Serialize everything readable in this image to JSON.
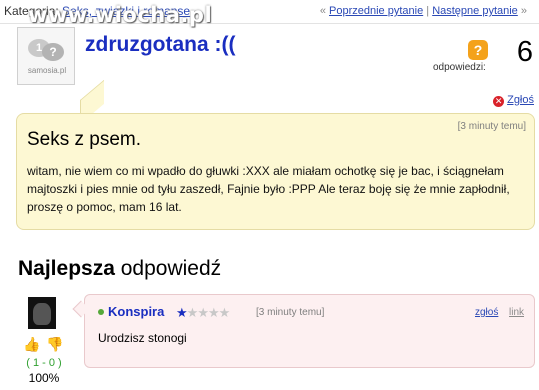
{
  "topbar": {
    "category_label": "Kategoria:",
    "category_link": "Seks, związki i romanse",
    "watermark": "www.wiocha.pl",
    "prev_link": "Poprzednie pytanie",
    "separator": "|",
    "next_link": "Następne pytanie",
    "prev_arrow": "«",
    "next_arrow": "»"
  },
  "asker": {
    "avatar_text": "samosia.pl",
    "avatar_glyph_1": "1",
    "avatar_glyph_2": "?",
    "username": "zdruzgotana :(("
  },
  "answers": {
    "count": "6",
    "label": "odpowiedzi:",
    "icon": "question-icon"
  },
  "report": {
    "label": "Zgłoś"
  },
  "question": {
    "time": "[3 minuty temu]",
    "title": "Seks z psem.",
    "body": "witam, nie wiem co mi wpadło do głuwki :XXX ale miałam ochotkę się je bac, i ściągnełam majtoszki i pies mnie od tyłu zaszedł, Fajnie było :PPP Ale teraz boję się że mnie zapłodnił, proszę o pomoc, mam 16 lat."
  },
  "best_answer": {
    "heading_bold": "Najlepsza",
    "heading_rest": "odpowiedź",
    "user": "Konspira",
    "rating_stars": 1,
    "max_stars": 5,
    "time": "[3 minuty temu]",
    "report_label": "zgłoś",
    "link_label": "link",
    "text": "Urodzisz stonogi",
    "votes": "( 1 - 0 )",
    "percent": "100%"
  },
  "colors": {
    "link": "#2a48b5",
    "username": "#1a2ec0",
    "question_bg": "#fdf8d3",
    "answer_bg": "#fdf0f1",
    "accent_orange": "#f4a21b"
  }
}
